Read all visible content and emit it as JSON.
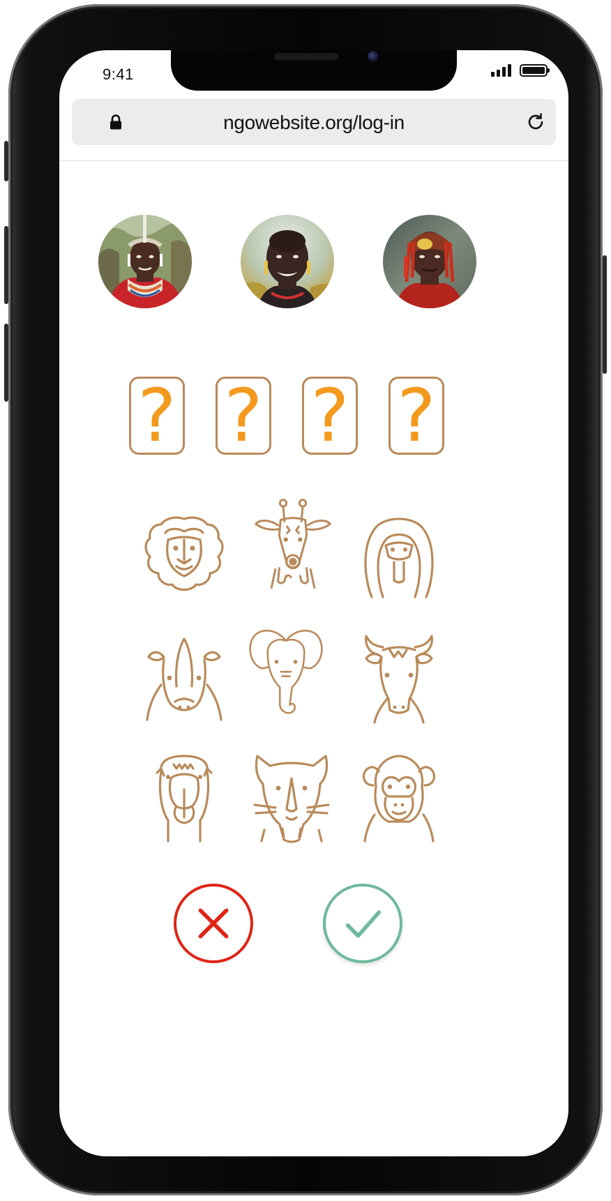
{
  "status_bar": {
    "time": "9:41",
    "signal_icon": "signal-bars-icon",
    "battery_icon": "battery-icon"
  },
  "browser": {
    "url": "ngowebsite.org/log-in",
    "lock_icon": "lock-icon",
    "reload_icon": "reload-icon"
  },
  "users": [
    {
      "id": "user-1",
      "kind": "portrait-photo"
    },
    {
      "id": "user-2",
      "kind": "portrait-photo"
    },
    {
      "id": "user-3",
      "kind": "portrait-photo"
    }
  ],
  "pin_slots": [
    "?",
    "?",
    "?",
    "?"
  ],
  "animals": [
    "lion",
    "giraffe",
    "cobra",
    "rhino",
    "elephant",
    "buffalo",
    "camel",
    "leopard",
    "monkey"
  ],
  "actions": {
    "cancel_icon": "close-icon",
    "confirm_icon": "checkmark-icon"
  },
  "colors": {
    "accent_brown": "#b98a5a",
    "question_orange": "#f39a1e",
    "cancel_red": "#e02414",
    "confirm_green": "#6fb99a"
  }
}
